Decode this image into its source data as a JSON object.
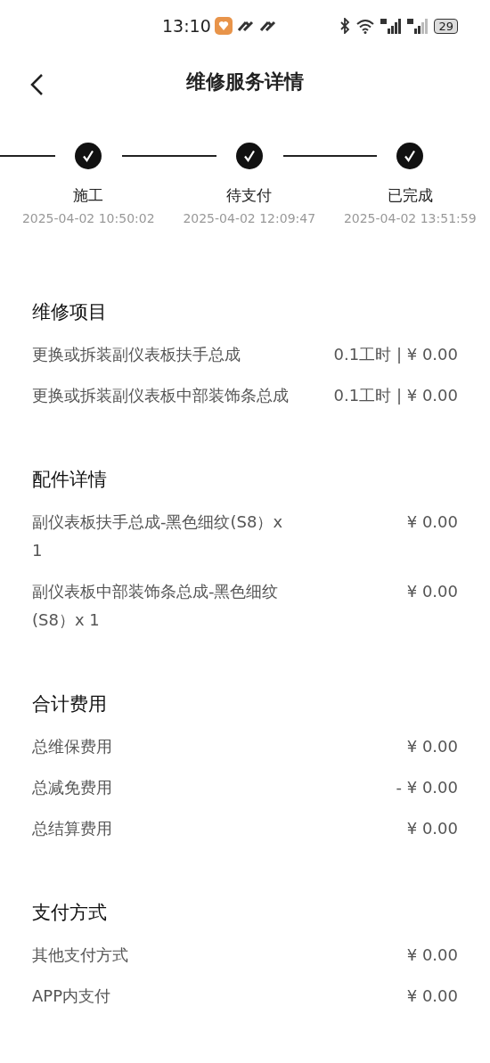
{
  "status_bar": {
    "time": "13:10",
    "battery": "29"
  },
  "header": {
    "title": "维修服务详情"
  },
  "steps": [
    {
      "label": "施工",
      "time": "2025-04-02 10:50:02",
      "completed": true
    },
    {
      "label": "待支付",
      "time": "2025-04-02 12:09:47",
      "completed": true
    },
    {
      "label": "已完成",
      "time": "2025-04-02 13:51:59",
      "completed": true
    }
  ],
  "sections": [
    {
      "title": "维修项目",
      "rows": [
        {
          "name": "更换或拆装副仪表板扶手总成",
          "value": "0.1工时 | ¥ 0.00"
        },
        {
          "name": "更换或拆装副仪表板中部装饰条总成",
          "value": "0.1工时 | ¥ 0.00"
        }
      ]
    },
    {
      "title": "配件详情",
      "rows": [
        {
          "name": "副仪表板扶手总成-黑色细纹(S8）x 1",
          "value": "¥ 0.00"
        },
        {
          "name": "副仪表板中部装饰条总成-黑色细纹(S8）x 1",
          "value": "¥ 0.00"
        }
      ]
    },
    {
      "title": "合计费用",
      "rows": [
        {
          "name": "总维保费用",
          "value": "¥ 0.00"
        },
        {
          "name": "总减免费用",
          "value": "- ¥ 0.00"
        },
        {
          "name": "总结算费用",
          "value": "¥ 0.00"
        }
      ]
    },
    {
      "title": "支付方式",
      "rows": [
        {
          "name": "其他支付方式",
          "value": "¥ 0.00"
        },
        {
          "name": "APP内支付",
          "value": "¥ 0.00"
        }
      ]
    }
  ]
}
